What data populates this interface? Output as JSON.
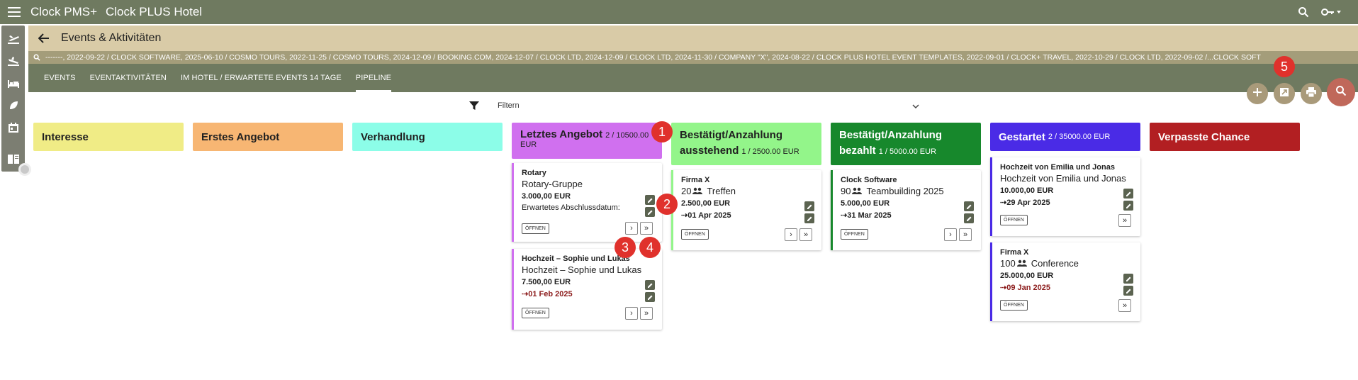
{
  "topbar": {
    "app_name": "Clock PMS+",
    "hotel_name": "Clock PLUS Hotel"
  },
  "page": {
    "title": "Events & Aktivitäten"
  },
  "breadcrumbs": [
    "-------, 2022-09-22 /",
    "CLOCK SOFTWARE, 2025-06-10 /",
    "COSMO TOURS, 2022-11-25 /",
    "COSMO TOURS, 2024-12-09 /",
    "BOOKING.COM, 2024-12-07 /",
    "CLOCK LTD, 2024-12-09 /",
    "CLOCK LTD, 2024-11-30 /",
    "COMPANY \"X\", 2024-08-22 /",
    "CLOCK PLUS HOTEL EVENT TEMPLATES, 2022-09-01 /",
    "CLOCK+ TRAVEL, 2022-10-29 /",
    "CLOCK LTD, 2022-09-02 /...CLOCK SOFT"
  ],
  "tabs": [
    {
      "label": "EVENTS"
    },
    {
      "label": "EVENTAKTIVITÄTEN"
    },
    {
      "label": "IM HOTEL / ERWARTETE EVENTS 14 TAGE"
    },
    {
      "label": "PIPELINE"
    }
  ],
  "filter": {
    "label": "Filtern"
  },
  "columns": [
    {
      "title": "Interesse",
      "count": "",
      "color": "#f0ec86"
    },
    {
      "title": "Erstes Angebot",
      "count": "",
      "color": "#f7b673"
    },
    {
      "title": "Verhandlung",
      "count": "",
      "color": "#8cfde8"
    },
    {
      "title": "Letztes Angebot",
      "count": "2 / 10500.00",
      "count2": "EUR",
      "color": "#d070ef"
    },
    {
      "title": "Bestätigt/Anzahlung",
      "title2": "ausstehend",
      "count": "1 / 2500.00 EUR",
      "color": "#93f58a"
    },
    {
      "title": "Bestätigt/Anzahlung",
      "title2": "bezahlt",
      "count": "1 / 5000.00 EUR",
      "color": "#17882c"
    },
    {
      "title": "Gestartet",
      "count": "2 / 35000.00 EUR",
      "color": "#4a2be6"
    },
    {
      "title": "Verpasste Chance",
      "count": "",
      "color": "#b21f22"
    }
  ],
  "cards": {
    "rotary": {
      "title": "Rotary",
      "subtitle": "Rotary-Gruppe",
      "amount": "3.000,00 EUR",
      "note": "Erwartetes Abschlussdatum:",
      "open": "ÖFFNEN"
    },
    "hochzeit_sl": {
      "title": "Hochzeit – Sophie und Lukas",
      "subtitle": "Hochzeit – Sophie und Lukas",
      "amount": "7.500,00 EUR",
      "date": "01 Feb 2025",
      "open": "ÖFFNEN"
    },
    "firma_x_1": {
      "title": "Firma X",
      "people": "20",
      "subtitle": "Treffen",
      "amount": "2.500,00 EUR",
      "date": "01 Apr 2025",
      "open": "ÖFFNEN"
    },
    "clock_sw": {
      "title": "Clock Software",
      "people": "90",
      "subtitle": "Teambuilding 2025",
      "amount": "5.000,00 EUR",
      "date": "31 Mar 2025",
      "open": "ÖFFNEN"
    },
    "hochzeit_ej": {
      "title": "Hochzeit von Emilia und Jonas",
      "subtitle": "Hochzeit von Emilia und Jonas",
      "amount": "10.000,00 EUR",
      "date": "29 Apr 2025",
      "open": "ÖFFNEN"
    },
    "firma_x_2": {
      "title": "Firma X",
      "people": "100",
      "subtitle": "Conference",
      "amount": "25.000,00 EUR",
      "date": "09 Jan 2025",
      "open": "ÖFFNEN"
    }
  },
  "markers": [
    "1",
    "2",
    "3",
    "4",
    "5"
  ],
  "icons": {
    "menu": "menu-icon",
    "search": "search-icon",
    "key": "key-icon",
    "back": "arrow-back-icon",
    "filter": "filter-icon",
    "add": "add-icon",
    "export": "export-icon",
    "print": "print-icon",
    "edit": "edit-icon",
    "people": "people-icon"
  },
  "colors": {
    "topbar": "#6f7a60",
    "titlebar": "#d9cba7",
    "crumbs": "#a49d7a",
    "marker": "#e0312c"
  }
}
